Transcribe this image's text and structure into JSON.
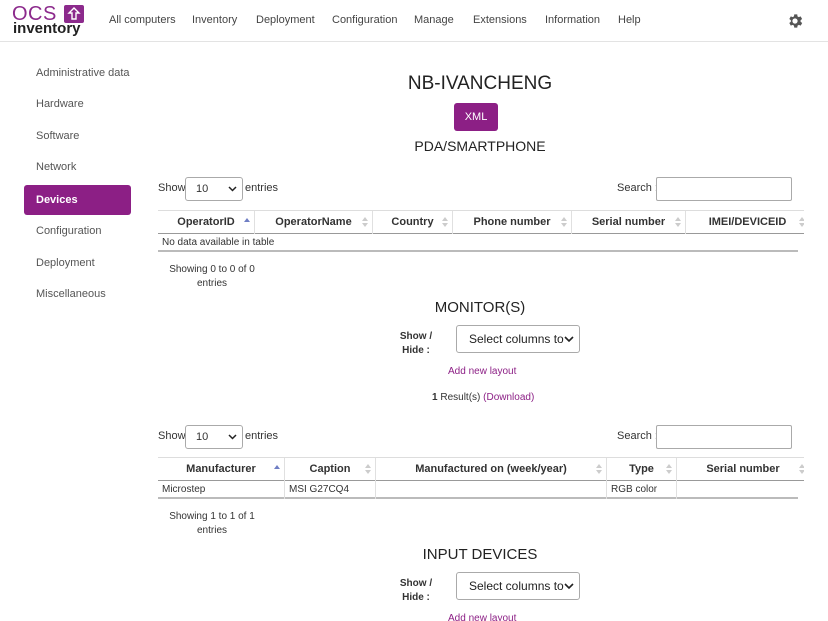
{
  "logo": {
    "line1": "OCS",
    "line2": "inventory"
  },
  "nav": [
    "All computers",
    "Inventory",
    "Deployment",
    "Configuration",
    "Manage",
    "Extensions",
    "Information",
    "Help"
  ],
  "sidebar": [
    "Administrative data",
    "Hardware",
    "Software",
    "Network",
    "Devices",
    "Configuration",
    "Deployment",
    "Miscellaneous"
  ],
  "sidebar_active": "Devices",
  "computer_name": "NB-IVANCHENG",
  "xml_button": "XML",
  "pda": {
    "title": "PDA/SMARTPHONE",
    "show_label": "Show",
    "entries_value": "10",
    "entries_label": "entries",
    "search_label": "Search :",
    "columns": [
      "OperatorID",
      "OperatorName",
      "Country",
      "Phone number",
      "Serial number",
      "IMEI/DEVICEID"
    ],
    "empty": "No data available in table",
    "info_line1": "Showing 0 to 0 of 0",
    "info_line2": "entries"
  },
  "monitors": {
    "title": "MONITOR(S)",
    "showhide_line1": "Show /",
    "showhide_line2": "Hide :",
    "select_placeholder": "Select columns to",
    "add_layout": "Add new layout",
    "result_count": "1",
    "result_text": "Result(s)",
    "download": "(Download)",
    "show_label": "Show",
    "entries_value": "10",
    "entries_label": "entries",
    "search_label": "Search :",
    "columns": [
      "Manufacturer",
      "Caption",
      "Manufactured on (week/year)",
      "Type",
      "Serial number"
    ],
    "rows": [
      [
        "Microstep",
        "MSI G27CQ4",
        "",
        "RGB color",
        ""
      ]
    ],
    "info_line1": "Showing 1 to 1 of 1",
    "info_line2": "entries"
  },
  "input_devices": {
    "title": "INPUT DEVICES",
    "showhide_line1": "Show /",
    "showhide_line2": "Hide :",
    "select_placeholder": "Select columns to",
    "add_layout": "Add new layout"
  },
  "colors": {
    "accent": "#8c1f85",
    "sort_active": "#6f7ec4"
  }
}
